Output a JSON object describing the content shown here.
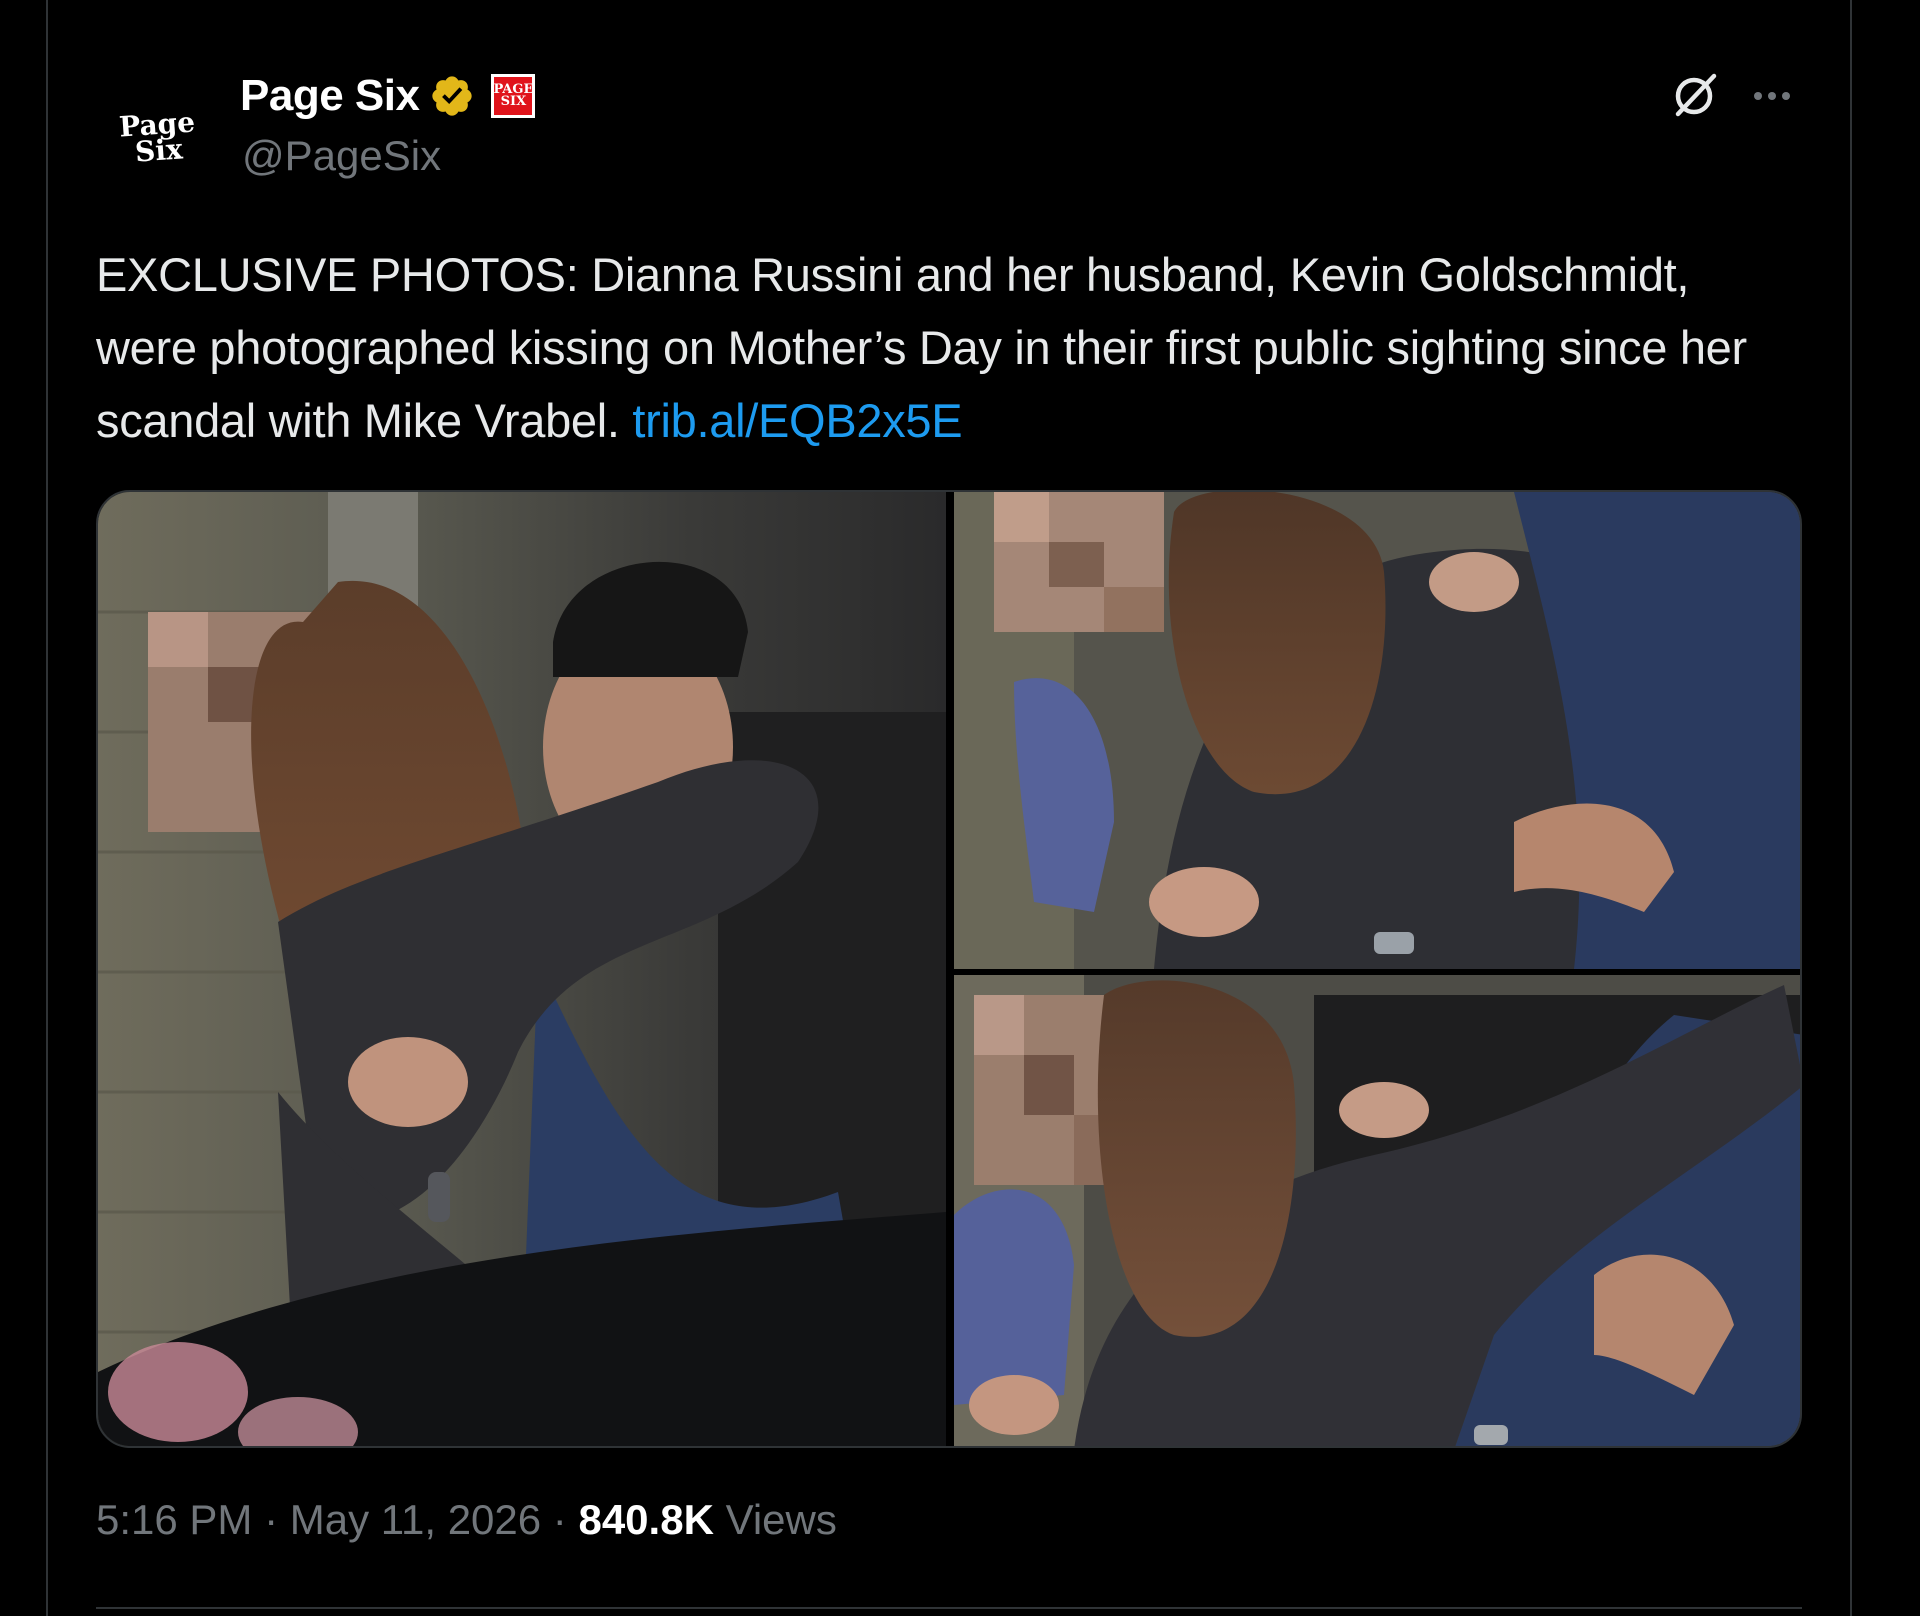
{
  "tweet": {
    "author": {
      "display_name": "Page Six",
      "handle": "@PageSix",
      "avatar_logo_text": "Page\nSix",
      "verified_badge_icon": "verified-gold-badge-icon",
      "affiliate_badge_text": "PAGE\nSIX",
      "affiliate_badge_color": "#e0131b",
      "verified_color": "#e2b719"
    },
    "actions": {
      "grok_icon": "grok-icon",
      "more_icon": "more-options-icon"
    },
    "text": {
      "body": "EXCLUSIVE PHOTOS: Dianna Russini and her husband, Kevin Goldschmidt, were photographed kissing on Mother’s Day in their first public sighting since her scandal with Mike Vrabel. ",
      "link": "trib.al/EQB2x5E",
      "link_color": "#1d9bf0"
    },
    "media": {
      "photo_count": 3
    },
    "meta": {
      "time": "5:16 PM",
      "separator": " · ",
      "date": "May 11, 2026",
      "views_count": "840.8K",
      "views_label": " Views"
    }
  }
}
